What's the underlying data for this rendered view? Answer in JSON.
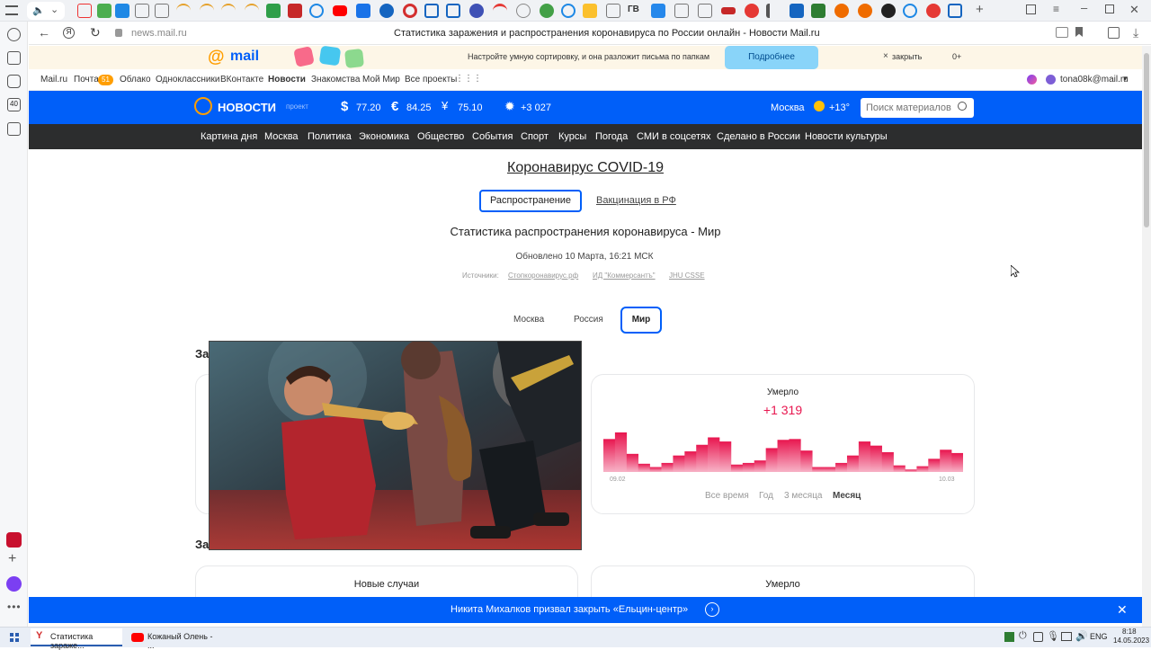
{
  "browser": {
    "page_title": "Статистика заражения и распространения коронавируса по России онлайн - Новости Mail.ru",
    "url": "news.mail.ru",
    "tab_labels": [
      "ГВ"
    ]
  },
  "promo": {
    "logo": "mail",
    "text": "Настройте умную сортировку, и она разложит письма по папкам",
    "button": "Подробнее",
    "close": "закрыть",
    "age": "0+"
  },
  "portal": {
    "links": [
      "Mail.ru",
      "Почта",
      "Облако",
      "Одноклассники",
      "ВКонтакте",
      "Новости",
      "Знакомства",
      "Мой Мир",
      "Все проекты"
    ],
    "mail_count": "51",
    "user": "tona08k@mail.ru"
  },
  "header": {
    "logo": "НОВОСТИ",
    "project": "проект",
    "usd": "77.20",
    "eur": "84.25",
    "other": "75.10",
    "virus": "+3 027",
    "city": "Москва",
    "temp": "+13°",
    "search_placeholder": "Поиск материалов"
  },
  "rubrics": [
    "Картина дня",
    "Москва",
    "Политика",
    "Экономика",
    "Общество",
    "События",
    "Спорт",
    "Курсы",
    "Погода",
    "СМИ в соцсетях",
    "Сделано в России",
    "Новости культуры"
  ],
  "main": {
    "title": "Коронавирус COVID-19",
    "tabs": [
      "Распространение",
      "Вакцинация в РФ"
    ],
    "heading": "Статистика распространения коронавируса - Мир",
    "updated": "Обновлено 10 Марта, 16:21 МСК",
    "sources_label": "Источники:",
    "sources": [
      "Стопкоронавирус.рф",
      "ИД \"Коммерсантъ\"",
      "JHU CSSE"
    ],
    "regions": [
      "Москва",
      "Россия",
      "Мир"
    ],
    "section1_prefix": "За",
    "section2_prefix": "За",
    "card_deaths_title": "Умерло",
    "card_deaths_value": "+1 319",
    "axis_start": "09.02",
    "axis_end": "10.03",
    "periods": [
      "Все время",
      "Год",
      "3 месяца",
      "Месяц"
    ],
    "card2_left_title": "Новые случаи",
    "card2_right_title": "Умерло"
  },
  "chart_data": {
    "type": "bar",
    "values": [
      40,
      48,
      22,
      10,
      6,
      11,
      20,
      25,
      33,
      42,
      37,
      9,
      11,
      14,
      29,
      39,
      40,
      26,
      6,
      6,
      11,
      20,
      37,
      32,
      24,
      8,
      3,
      7,
      16,
      27,
      23
    ],
    "x_start": "09.02",
    "x_end": "10.03",
    "color_top": "#e8164f",
    "color_bottom": "#f7b3c7"
  },
  "breaking": {
    "text": "Никита Михалков призвал закрыть «Ельцин-центр»"
  },
  "taskbar": {
    "items": [
      "Статистика зараже...",
      "Кожаный Олень - ..."
    ],
    "lang": "ENG",
    "time": "8:18",
    "date": "14.05.2023"
  }
}
